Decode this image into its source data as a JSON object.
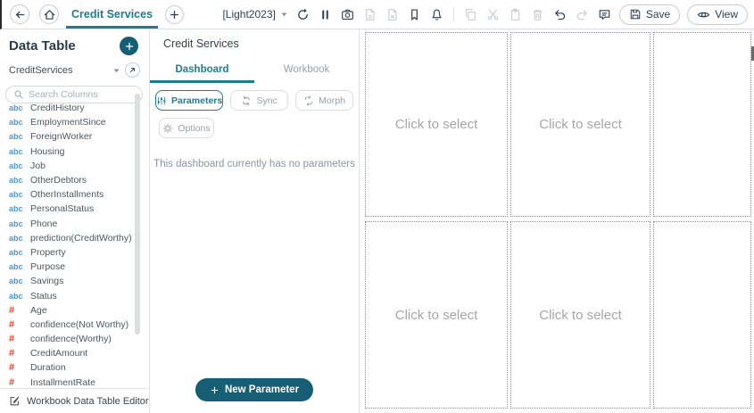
{
  "topbar": {
    "tab_title": "Credit Services",
    "theme_selector": "[Light2023]",
    "tools": [
      {
        "name": "refresh",
        "enabled": true
      },
      {
        "name": "pause",
        "enabled": true
      },
      {
        "name": "camera",
        "enabled": true
      },
      {
        "name": "file-pdf",
        "enabled": false
      },
      {
        "name": "file-excel",
        "enabled": false
      },
      {
        "name": "bookmark",
        "enabled": true
      },
      {
        "name": "bell",
        "enabled": true
      },
      {
        "name": "divider"
      },
      {
        "name": "copy",
        "enabled": false
      },
      {
        "name": "cut",
        "enabled": false
      },
      {
        "name": "paste",
        "enabled": false
      },
      {
        "name": "trash",
        "enabled": false
      },
      {
        "name": "undo",
        "enabled": true
      },
      {
        "name": "redo",
        "enabled": false
      },
      {
        "name": "comment",
        "enabled": true
      }
    ],
    "save_label": "Save",
    "view_label": "View"
  },
  "sidebar": {
    "title": "Data Table",
    "table_name": "CreditServices",
    "search_placeholder": "Search Columns",
    "column_kind_glyphs": {
      "text": "abc",
      "number": "#"
    },
    "columns": [
      {
        "kind": "text",
        "name": "CreditHistory"
      },
      {
        "kind": "text",
        "name": "EmploymentSince"
      },
      {
        "kind": "text",
        "name": "ForeignWorker"
      },
      {
        "kind": "text",
        "name": "Housing"
      },
      {
        "kind": "text",
        "name": "Job"
      },
      {
        "kind": "text",
        "name": "OtherDebtors"
      },
      {
        "kind": "text",
        "name": "OtherInstallments"
      },
      {
        "kind": "text",
        "name": "PersonalStatus"
      },
      {
        "kind": "text",
        "name": "Phone"
      },
      {
        "kind": "text",
        "name": "prediction(CreditWorthy)"
      },
      {
        "kind": "text",
        "name": "Property"
      },
      {
        "kind": "text",
        "name": "Purpose"
      },
      {
        "kind": "text",
        "name": "Savings"
      },
      {
        "kind": "text",
        "name": "Status"
      },
      {
        "kind": "number",
        "name": "Age"
      },
      {
        "kind": "number",
        "name": "confidence(Not Worthy)"
      },
      {
        "kind": "number",
        "name": "confidence(Worthy)"
      },
      {
        "kind": "number",
        "name": "CreditAmount"
      },
      {
        "kind": "number",
        "name": "Duration"
      },
      {
        "kind": "number",
        "name": "InstallmentRate"
      }
    ],
    "footer_label": "Workbook Data Table Editor"
  },
  "panel": {
    "title": "Credit Services",
    "tabs": [
      {
        "label": "Dashboard",
        "active": true
      },
      {
        "label": "Workbook",
        "active": false
      }
    ],
    "parameters_label": "Parameters",
    "sync_label": "Sync",
    "morph_label": "Morph",
    "options_label": "Options",
    "empty_message": "This dashboard currently has no parameters",
    "new_parameter_label": "New Parameter"
  },
  "canvas": {
    "placeholder": "Click to select"
  },
  "colors": {
    "accent": "#1e7c8f",
    "accent_dark": "#165e74",
    "text_dark": "#2f4050",
    "disabled_icon": "#c8cdd4",
    "column_text_icon": "#4a97d4",
    "column_number_icon": "#e8442a"
  }
}
